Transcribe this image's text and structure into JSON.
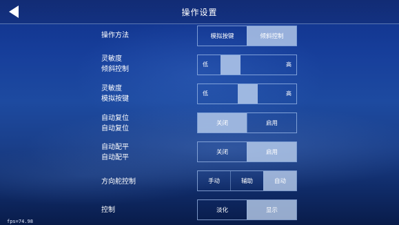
{
  "header": {
    "title": "操作设置",
    "back_icon": "back-arrow-icon"
  },
  "rows": [
    {
      "label_lines": [
        "操作方法"
      ],
      "type": "segmented",
      "options": [
        "模拟按键",
        "倾斜控制"
      ],
      "selected_index": 1
    },
    {
      "label_lines": [
        "灵敏度",
        "倾斜控制"
      ],
      "type": "slider",
      "low_label": "低",
      "high_label": "高",
      "value_fraction": 0.29
    },
    {
      "label_lines": [
        "灵敏度",
        "模拟按键"
      ],
      "type": "slider",
      "low_label": "低",
      "high_label": "高",
      "value_fraction": 0.51
    },
    {
      "label_lines": [
        "自动复位",
        "自动复位"
      ],
      "type": "segmented",
      "options": [
        "关闭",
        "启用"
      ],
      "selected_index": 0
    },
    {
      "label_lines": [
        "自动配平",
        "自动配平"
      ],
      "type": "segmented",
      "options": [
        "关闭",
        "启用"
      ],
      "selected_index": 1
    },
    {
      "label_lines": [
        "方向舵控制"
      ],
      "type": "segmented",
      "options": [
        "手动",
        "辅助",
        "自动"
      ],
      "selected_index": 2
    },
    {
      "label_lines": [
        "控制"
      ],
      "type": "segmented",
      "options": [
        "淡化",
        "显示"
      ],
      "selected_index": 1
    }
  ],
  "fps_text": "fps=74.98"
}
